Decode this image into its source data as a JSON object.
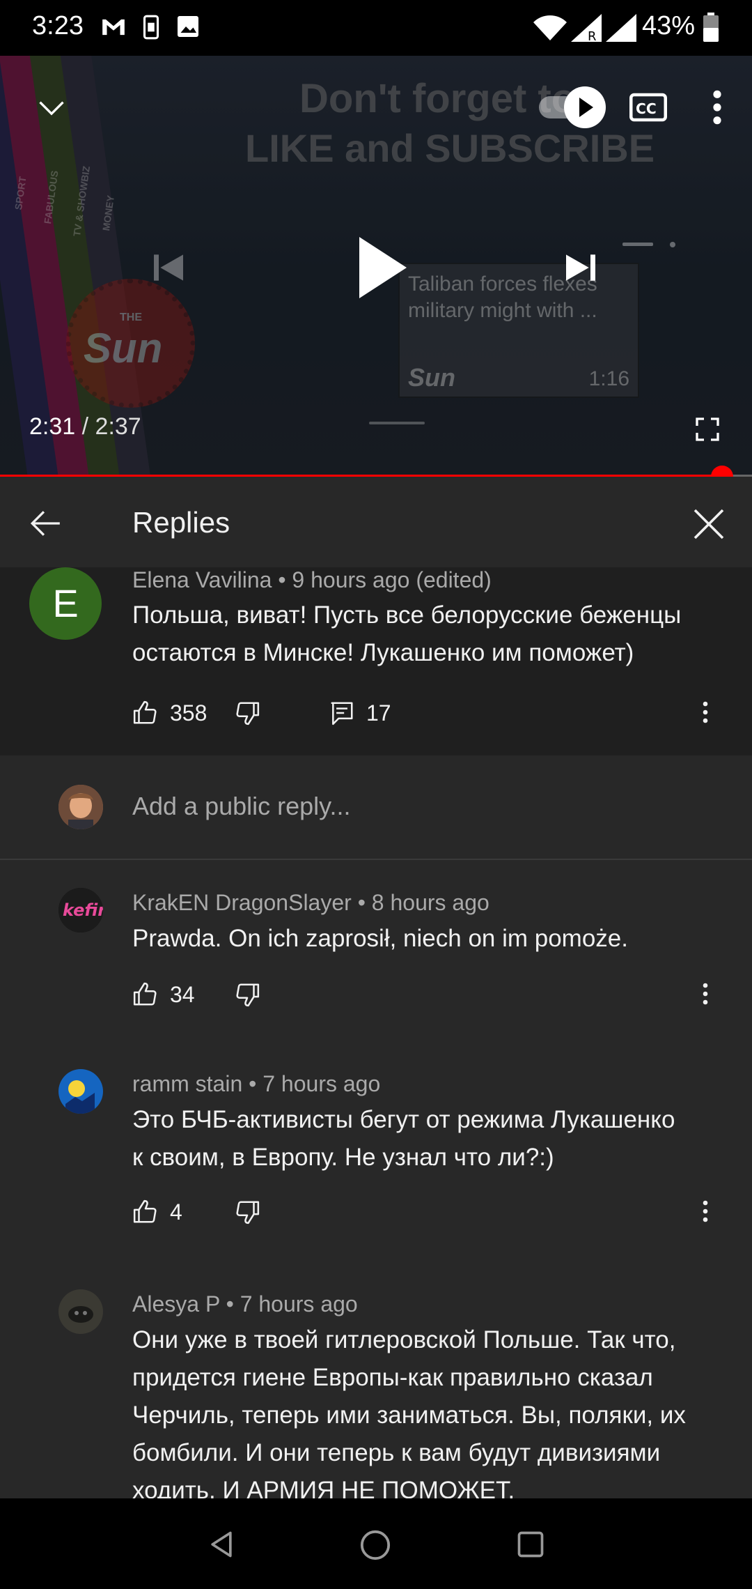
{
  "status_bar": {
    "time": "3:23",
    "battery": "43%",
    "icons": [
      "gmail-icon",
      "sim-icon",
      "gallery-icon",
      "wifi-icon",
      "signal-roaming-icon",
      "signal-icon",
      "battery-icon"
    ]
  },
  "player": {
    "headline_line1": "Don't forget to",
    "headline_line2": "LIKE and SUBSCRIBE",
    "stripe_labels": [
      "SPORT",
      "FABULOUS",
      "TV & SHOWBIZ",
      "MONEY"
    ],
    "logo_small": "THE",
    "logo_text": "Sun",
    "next_video_title": "Taliban forces flexes military might with ...",
    "next_video_duration": "1:16",
    "current_time": "2:31",
    "separator": " / ",
    "duration": "2:37",
    "progress": 0.96,
    "accent_color": "#ff0000",
    "autoplay": "on"
  },
  "replies_panel": {
    "title": "Replies",
    "parent_comment": {
      "author": "Elena Vavilina",
      "time": "9 hours ago (edited)",
      "avatar_letter": "E",
      "text_line1": "Польша, виват! Пусть все белорусские беженцы",
      "text_line2": "остаются в Минске! Лукашенко им поможет)",
      "likes": "358",
      "replies": "17"
    },
    "reply_input": {
      "placeholder": "Add a public reply..."
    },
    "replies": [
      {
        "author": "KrakEN DragonSlayer",
        "time": "8 hours ago",
        "lines": [
          "Prawda. On ich zaprosił, niech on im pomoże."
        ],
        "likes": "34"
      },
      {
        "author": "ramm stain",
        "time": "7 hours ago",
        "lines": [
          "Это БЧБ-активисты бегут от режима Лукашенко",
          "к своим, в Европу. Не узнал что ли?:)"
        ],
        "likes": "4"
      },
      {
        "author": "Alesya P",
        "time": "7 hours ago",
        "lines": [
          "Они уже в твоей гитлеровской Польше. Так  что,",
          "придется гиене Европы-как правильно сказал",
          "Черчиль, теперь ими заниматься. Вы, поляки, их",
          "бомбили. И они теперь к вам будут дивизиями",
          "ходить. И АРМИЯ НЕ ПОМОЖЕТ."
        ]
      }
    ],
    "meta_separator": "•"
  }
}
